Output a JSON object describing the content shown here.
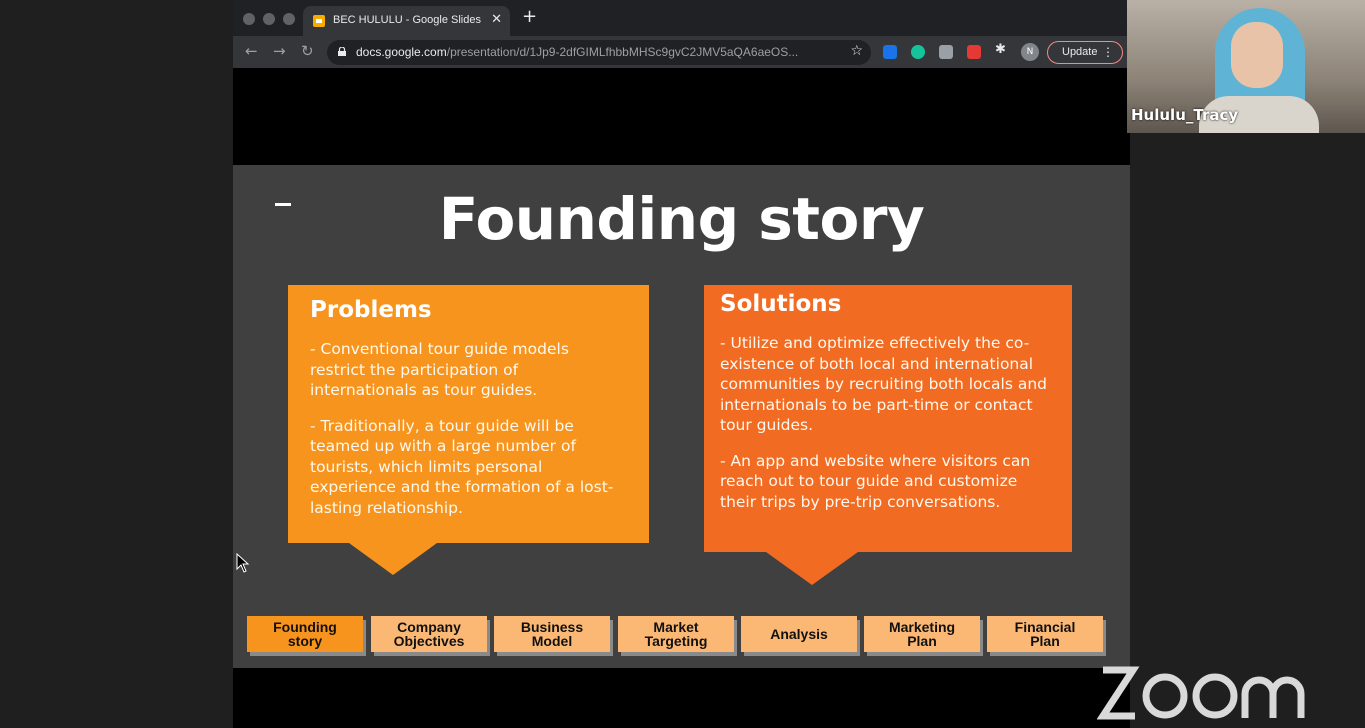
{
  "browser": {
    "tab_title": "BEC HULULU - Google Slides",
    "tab_close": "✕",
    "new_tab": "+",
    "url_domain": "docs.google.com",
    "url_path": "/presentation/d/1Jp9-2dfGIMLfhbbMHSc9gvC2JMV5aQA6aeOS...",
    "profile_initial": "N",
    "update_label": "Update",
    "update_menu": "⋮",
    "back": "←",
    "forward": "→",
    "reload": "↻",
    "star": "☆"
  },
  "slide": {
    "title": "Founding story",
    "problems": {
      "heading": "Problems",
      "paragraphs": [
        "- Conventional tour guide models restrict the participation of internationals as tour guides.",
        "- Traditionally,  a tour guide will be teamed up with a large number of tourists, which limits personal experience and the formation of a lost-lasting relationship."
      ]
    },
    "solutions": {
      "heading": "Solutions",
      "paragraphs": [
        "- Utilize and optimize effectively the co-existence of both local and international communities by recruiting both locals and internationals to be part-time or contact tour guides.",
        "- An app and website where visitors can reach out to tour guide and customize their trips by pre-trip conversations."
      ]
    },
    "nav_buttons": [
      {
        "line1": "Founding",
        "line2": "story"
      },
      {
        "line1": "Company",
        "line2": "Objectives"
      },
      {
        "line1": "Business",
        "line2": "Model"
      },
      {
        "line1": "Market",
        "line2": "Targeting"
      },
      {
        "line1": "Analysis",
        "line2": ""
      },
      {
        "line1": "Marketing",
        "line2": "Plan"
      },
      {
        "line1": "Financial",
        "line2": "Plan"
      }
    ],
    "active_nav_index": 0
  },
  "video": {
    "participant_name": "Hululu_Tracy"
  },
  "colors": {
    "problems_bg": "#f7941d",
    "solutions_bg": "#f26b22",
    "nav_bg": "#fbb874",
    "slide_bg": "#404040"
  }
}
